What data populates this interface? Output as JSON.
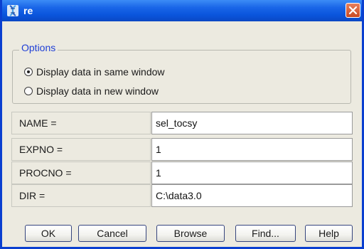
{
  "window": {
    "title": "re",
    "app_icon": "dna-icon",
    "close_icon": "close-icon",
    "titlebar_color": "#0a55dc",
    "close_color": "#d25a30"
  },
  "options": {
    "legend": "Options",
    "legend_color": "#1f3fd6",
    "radios": [
      {
        "label": "Display data in same window",
        "selected": true
      },
      {
        "label": "Display data in new window",
        "selected": false
      }
    ]
  },
  "fields": [
    {
      "label": "NAME =",
      "value": "sel_tocsy"
    },
    {
      "label": "EXPNO =",
      "value": "1"
    },
    {
      "label": "PROCNO =",
      "value": "1"
    },
    {
      "label": "DIR =",
      "value": "C:\\data3.0"
    }
  ],
  "buttons": {
    "ok": "OK",
    "cancel": "Cancel",
    "browse": "Browse",
    "find": "Find...",
    "help": "Help"
  }
}
